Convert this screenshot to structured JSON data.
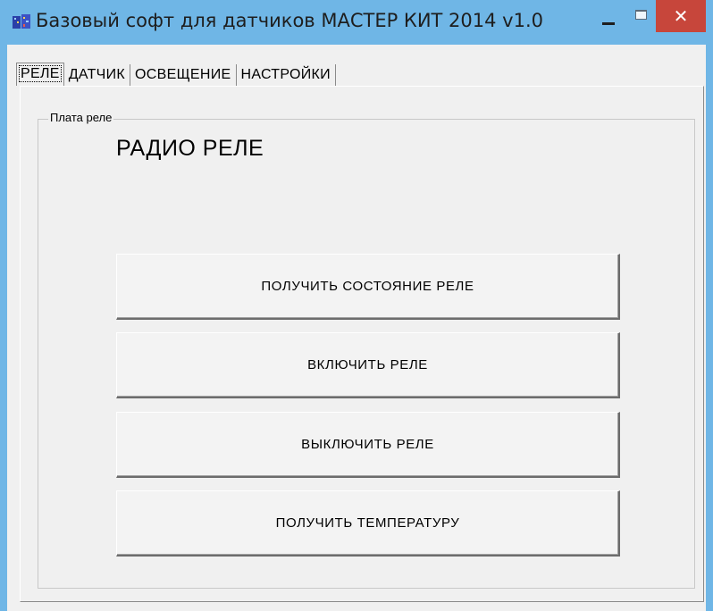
{
  "window": {
    "title": "Базовый софт для датчиков МАСТЕР КИТ 2014 v1.0",
    "close_glyph": "✕",
    "accent": "#6fb6e6",
    "close_color": "#c7463b"
  },
  "tabs": [
    {
      "label": "РЕЛЕ",
      "active": true
    },
    {
      "label": "ДАТЧИК",
      "active": false
    },
    {
      "label": "ОСВЕЩЕНИЕ",
      "active": false
    },
    {
      "label": "НАСТРОЙКИ",
      "active": false
    }
  ],
  "group": {
    "title": "Плата реле",
    "heading": "РАДИО РЕЛЕ"
  },
  "buttons": {
    "get_state": "ПОЛУЧИТЬ СОСТОЯНИЕ РЕЛЕ",
    "turn_on": "ВКЛЮЧИТЬ РЕЛЕ",
    "turn_off": "ВЫКЛЮЧИТЬ РЕЛЕ",
    "get_temp": "ПОЛУЧИТЬ ТЕМПЕРАТУРУ"
  }
}
